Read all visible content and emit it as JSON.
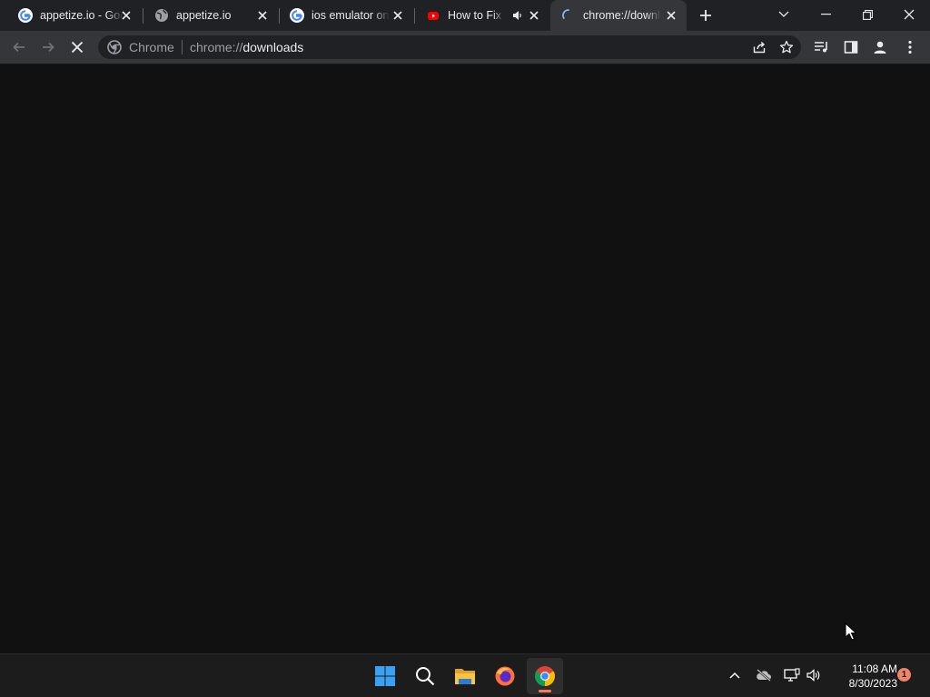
{
  "tabs": [
    {
      "title": "appetize.io - Google Search",
      "favicon": "google-g-icon",
      "active": false
    },
    {
      "title": "appetize.io",
      "favicon": "globe-icon",
      "active": false
    },
    {
      "title": "ios emulator online - Google Search",
      "favicon": "google-g-icon",
      "active": false
    },
    {
      "title": "How to Fix YouTube",
      "favicon": "youtube-icon",
      "active": false,
      "audio": true
    },
    {
      "title": "chrome://downloads",
      "favicon": "loading-spinner-icon",
      "active": true
    }
  ],
  "window_controls": [
    "tab-search",
    "minimize",
    "restore",
    "close"
  ],
  "toolbar": {
    "back": "back-arrow-icon",
    "forward": "forward-arrow-icon",
    "reload": "stop-loading-icon"
  },
  "omnibox": {
    "chip": "Chrome",
    "url_prefix": "chrome://",
    "url_host": "downloads"
  },
  "taskbar": {
    "apps": [
      "windows-start-icon",
      "search-icon",
      "file-explorer-icon",
      "firefox-icon",
      "chrome-icon"
    ],
    "active_app": "chrome-icon",
    "time": "11:08 AM",
    "date": "8/30/2023",
    "notification_count": "1"
  },
  "colors": {
    "tabstrip": "#202124",
    "toolbar": "#35363a",
    "content": "#111112",
    "taskbar": "#1c1c1c",
    "accent": "#ff7a5c"
  }
}
